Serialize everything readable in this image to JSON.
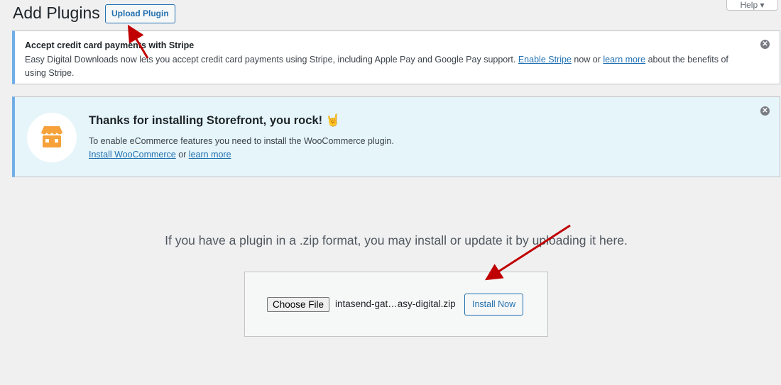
{
  "header": {
    "title": "Add Plugins",
    "upload_label": "Upload Plugin",
    "help_label": "Help ▾"
  },
  "stripe_notice": {
    "title": "Accept credit card payments with Stripe",
    "text": "Easy Digital Downloads now lets you accept credit card payments using Stripe, including Apple Pay and Google Pay support. ",
    "link1": "Enable Stripe",
    "mid": " now or ",
    "link2": "learn more",
    "tail": " about the benefits of using Stripe.",
    "close": "✕"
  },
  "storefront_notice": {
    "title": "Thanks for installing Storefront, you rock! 🤘",
    "text": "To enable eCommerce features you need to install the WooCommerce plugin.",
    "link1": "Install WooCommerce",
    "mid": " or ",
    "link2": "learn more",
    "close": "✕"
  },
  "upload": {
    "message": "If you have a plugin in a .zip format, you may install or update it by uploading it here.",
    "choose_label": "Choose File",
    "file_name": "intasend-gat…asy-digital.zip",
    "install_label": "Install Now"
  },
  "colors": {
    "accent": "#2271b1",
    "arrow": "#c00000",
    "store": "#f6a13a"
  }
}
